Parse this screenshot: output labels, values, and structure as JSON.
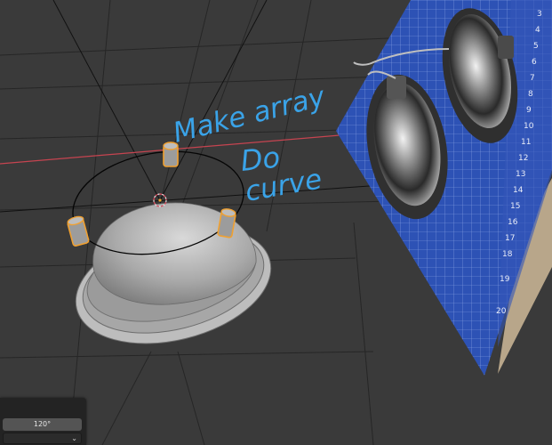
{
  "annotations": {
    "line1": "Make array",
    "line2": "Do",
    "line3": "curve"
  },
  "reference_image": {
    "ruler_numbers": [
      "3",
      "4",
      "5",
      "6",
      "7",
      "8",
      "9",
      "10",
      "11",
      "12",
      "13",
      "14",
      "15",
      "16",
      "17",
      "18",
      "19",
      "20"
    ]
  },
  "operator_panel": {
    "angle_value": "120°",
    "dropdown_icon": "chevron-down-icon"
  },
  "colors": {
    "viewport_bg": "#3a3a3a",
    "x_axis": "#d04a55",
    "selection": "#f0a030",
    "annotation_ink": "#3aa3e8",
    "mat_blue": "#2b4fb0"
  }
}
